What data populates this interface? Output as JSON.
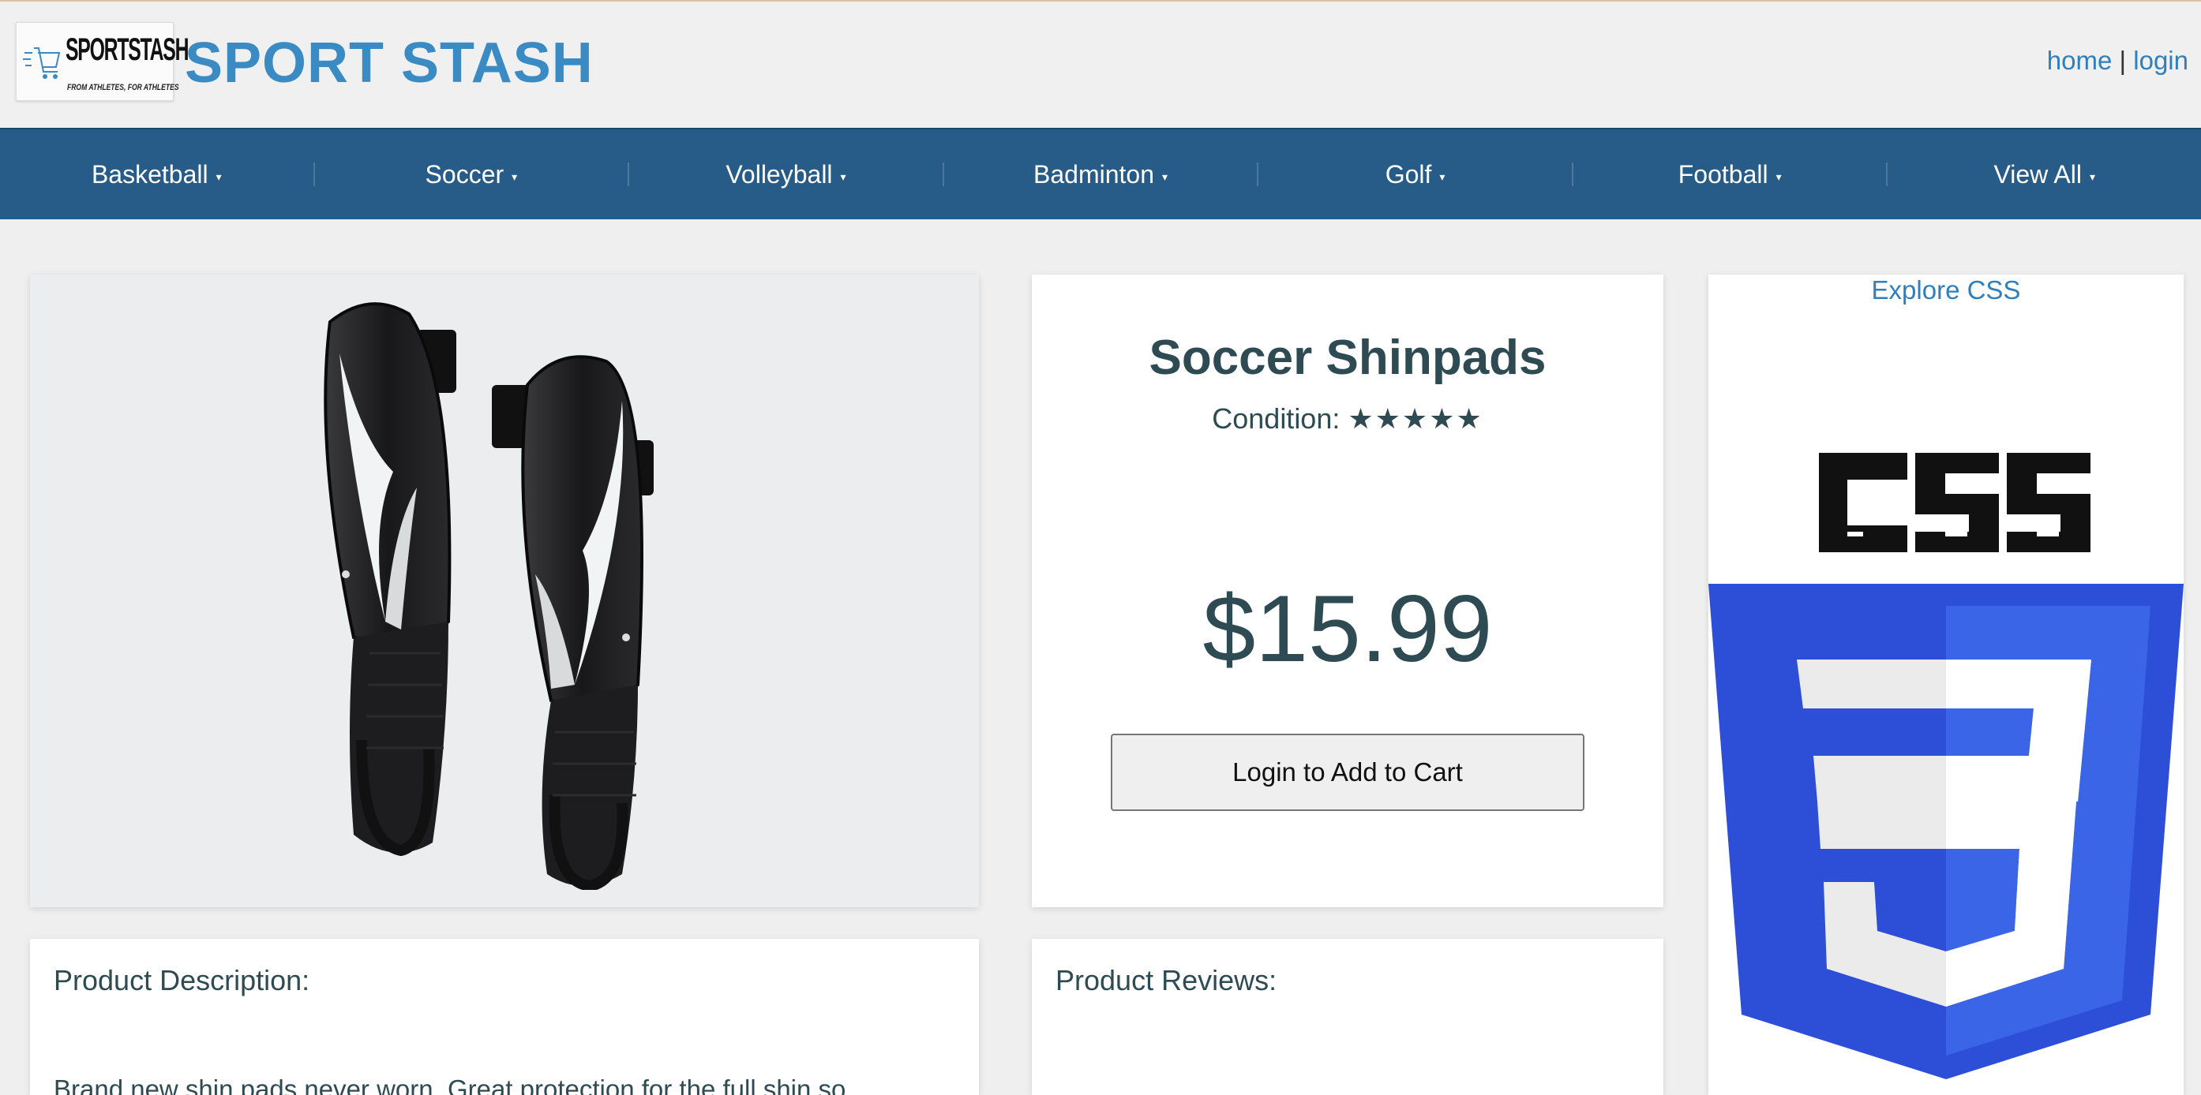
{
  "header": {
    "logo_word": "SPORTSTASH",
    "logo_tagline": "FROM ATHLETES, FOR ATHLETES",
    "site_title": "SPORT STASH",
    "links": {
      "home": "home",
      "separator": "|",
      "login": "login"
    }
  },
  "nav": {
    "items": [
      {
        "label": "Basketball"
      },
      {
        "label": "Soccer"
      },
      {
        "label": "Volleyball"
      },
      {
        "label": "Badminton"
      },
      {
        "label": "Golf"
      },
      {
        "label": "Football"
      },
      {
        "label": "View All"
      }
    ],
    "caret": "▾"
  },
  "product": {
    "title": "Soccer Shinpads",
    "condition_label": "Condition:",
    "condition_stars": "★★★★★",
    "condition_rating": 5,
    "price": "$15.99",
    "cart_button": "Login to Add to Cart",
    "image_icon": "shin-guards-image"
  },
  "ad": {
    "link": "Explore CSS",
    "logo_text": "CSS",
    "logo_digit": "3"
  },
  "description": {
    "heading": "Product Description:",
    "text": "Brand new shin pads never worn. Great protection for the full shin so"
  },
  "reviews": {
    "heading": "Product Reviews:"
  },
  "colors": {
    "title_blue": "#3a8bc4",
    "nav_bg": "#275c88",
    "link_blue": "#2f7fbf",
    "text_dark": "#2e4a52",
    "css_blue": "#2d4fd8"
  }
}
